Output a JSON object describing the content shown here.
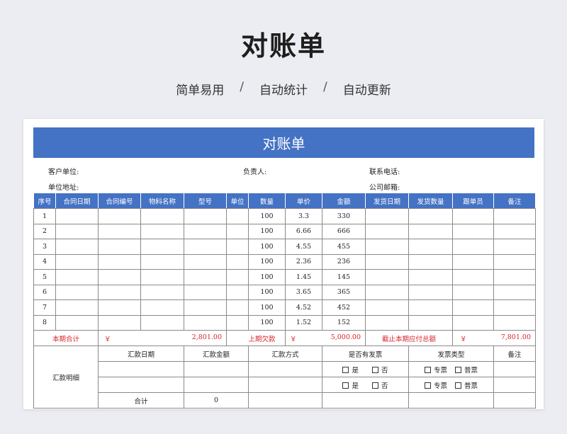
{
  "hero": {
    "title": "对账单",
    "tags": [
      "简单易用",
      "自动统计",
      "自动更新"
    ],
    "separator": "/"
  },
  "sheet": {
    "title": "对账单",
    "info": {
      "customer_label": "客户单位:",
      "manager_label": "负责人:",
      "phone_label": "联系电话:",
      "address_label": "单位地址:",
      "email_label": "公司邮箱:"
    },
    "headers": [
      "序号",
      "合同日期",
      "合同编号",
      "物料名称",
      "型号",
      "单位",
      "数量",
      "单价",
      "金额",
      "发货日期",
      "发货数量",
      "跟单员",
      "备注"
    ],
    "rows": [
      {
        "no": "1",
        "qty": "100",
        "price": "3.3",
        "amount": "330"
      },
      {
        "no": "2",
        "qty": "100",
        "price": "6.66",
        "amount": "666"
      },
      {
        "no": "3",
        "qty": "100",
        "price": "4.55",
        "amount": "455"
      },
      {
        "no": "4",
        "qty": "100",
        "price": "2.36",
        "amount": "236"
      },
      {
        "no": "5",
        "qty": "100",
        "price": "1.45",
        "amount": "145"
      },
      {
        "no": "6",
        "qty": "100",
        "price": "3.65",
        "amount": "365"
      },
      {
        "no": "7",
        "qty": "100",
        "price": "4.52",
        "amount": "452"
      },
      {
        "no": "8",
        "qty": "100",
        "price": "1.52",
        "amount": "152"
      }
    ],
    "totals": {
      "current_label": "本期合计",
      "currency": "￥",
      "current_value": "2,801.00",
      "prev_label": "上期欠款",
      "prev_value": "5,000.00",
      "due_label": "截止本期应付总额",
      "due_value": "7,801.00"
    },
    "remit": {
      "section_label": "汇款明细",
      "headers": [
        "汇款日期",
        "汇款金额",
        "汇款方式",
        "是否有发票",
        "发票类型",
        "备注"
      ],
      "yes": "是",
      "no": "否",
      "special": "专票",
      "normal": "普票",
      "sum_label": "合计",
      "sum_value": "0"
    }
  }
}
